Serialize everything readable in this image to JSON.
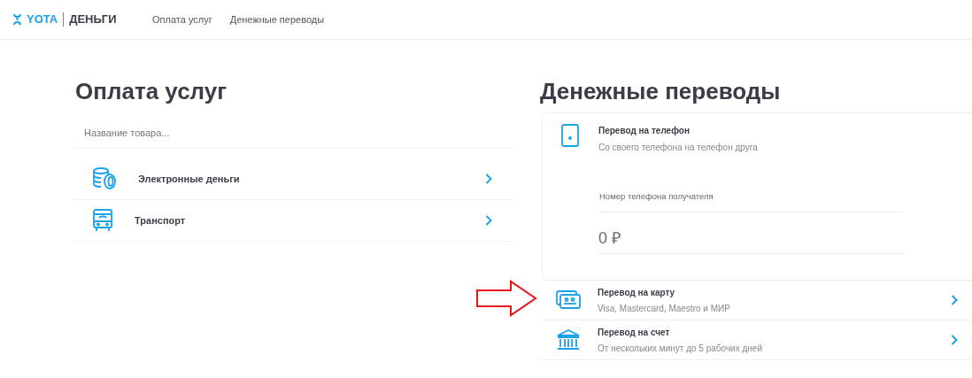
{
  "header": {
    "logo_brand": "YOTA",
    "logo_product": "ДЕНЬГИ",
    "nav": [
      {
        "label": "Оплата услуг"
      },
      {
        "label": "Денежные переводы"
      }
    ]
  },
  "payments": {
    "title": "Оплата услуг",
    "search": {
      "placeholder": "Название товара..."
    },
    "items": [
      {
        "label": "Электронные деньги"
      },
      {
        "label": "Транспорт"
      }
    ]
  },
  "transfers": {
    "title": "Денежные переводы",
    "phone": {
      "title": "Перевод на телефон",
      "subtitle": "Со своего телефона на телефон друга",
      "recipient_field": {
        "placeholder": "Номер телефона получателя"
      },
      "amount_field": {
        "value": "0 ₽"
      }
    },
    "items": [
      {
        "title": "Перевод на карту",
        "subtitle": "Visa, Mastercard, Maestro и МИР",
        "highlighted": true
      },
      {
        "title": "Перевод на счет",
        "subtitle": "От нескольких минут до 5 рабочих дней",
        "highlighted": false
      }
    ]
  }
}
